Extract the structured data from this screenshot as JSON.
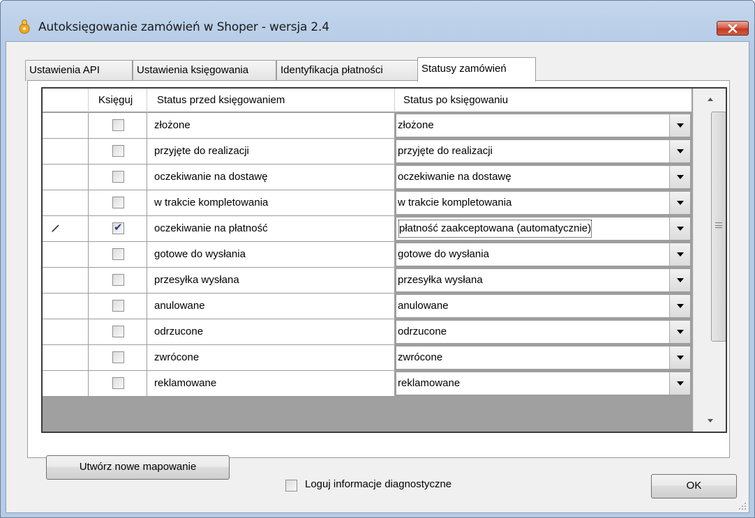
{
  "window": {
    "title": "Autoksięgowanie zamówień w Shoper - wersja 2.4"
  },
  "tabs": [
    {
      "label": "Ustawienia API",
      "active": false
    },
    {
      "label": "Ustawienia księgowania",
      "active": false
    },
    {
      "label": "Identyfikacja płatności",
      "active": false
    },
    {
      "label": "Statusy zamówień",
      "active": true
    }
  ],
  "grid": {
    "columns": {
      "post": "Księguj",
      "before": "Status przed księgowaniem",
      "after": "Status po księgowaniu"
    },
    "rows": [
      {
        "post": false,
        "before": "złożone",
        "after": "złożone",
        "editing": false
      },
      {
        "post": false,
        "before": "przyjęte do realizacji",
        "after": "przyjęte do realizacji",
        "editing": false
      },
      {
        "post": false,
        "before": "oczekiwanie na dostawę",
        "after": "oczekiwanie na dostawę",
        "editing": false
      },
      {
        "post": false,
        "before": "w trakcie kompletowania",
        "after": "w trakcie kompletowania",
        "editing": false
      },
      {
        "post": true,
        "before": "oczekiwanie na płatność",
        "after": "płatność zaakceptowana (automatycznie)",
        "editing": true
      },
      {
        "post": false,
        "before": "gotowe do wysłania",
        "after": "gotowe do wysłania",
        "editing": false
      },
      {
        "post": false,
        "before": "przesyłka wysłana",
        "after": "przesyłka wysłana",
        "editing": false
      },
      {
        "post": false,
        "before": "anulowane",
        "after": "anulowane",
        "editing": false
      },
      {
        "post": false,
        "before": "odrzucone",
        "after": "odrzucone",
        "editing": false
      },
      {
        "post": false,
        "before": "zwrócone",
        "after": "zwrócone",
        "editing": false
      },
      {
        "post": false,
        "before": "reklamowane",
        "after": "reklamowane",
        "editing": false
      }
    ]
  },
  "buttons": {
    "new_mapping": "Utwórz nowe mapowanie",
    "ok": "OK"
  },
  "options": {
    "log_diagnostics_label": "Loguj informacje diagnostyczne",
    "log_diagnostics_checked": false
  },
  "colors": {
    "close_button": "#c43a23",
    "title_bar": "#b5cbe6",
    "checkmark": "#2c3a7a"
  },
  "icons": {
    "app": "app-icon",
    "close": "close-icon",
    "row_edit": "pencil-icon",
    "check": "checkmark-icon",
    "dropdown": "chevron-down-icon"
  }
}
